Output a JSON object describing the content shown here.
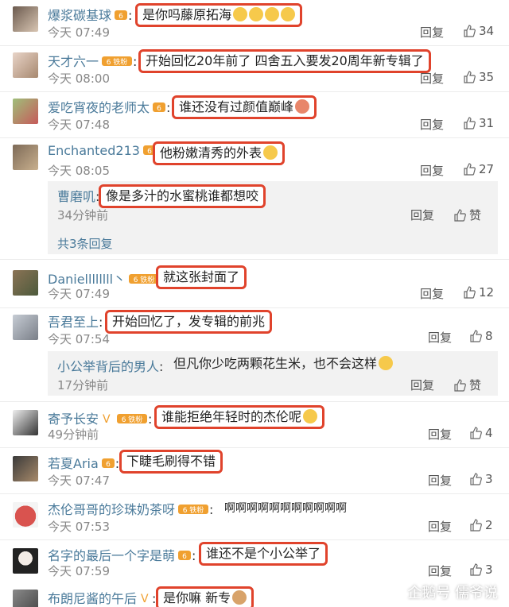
{
  "comments": [
    {
      "name": "爆浆碳基球",
      "content": "是你吗藤原拓海",
      "time": "今天 07:49",
      "reply": "回复",
      "likes": "34"
    },
    {
      "name": "天才六一",
      "content": "开始回忆20年前了 四舍五入要发20周年新专辑了",
      "time": "今天 08:00",
      "reply": "回复",
      "likes": "35"
    },
    {
      "name": "爱吃宵夜的老师太",
      "content": "谁还没有过颜值巅峰",
      "time": "今天 07:48",
      "reply": "回复",
      "likes": "31"
    },
    {
      "name": "Enchanted213",
      "content": "他粉嫩清秀的外表",
      "time": "今天 08:05",
      "reply": "回复",
      "likes": "27"
    },
    {
      "name": "Daniellllllll丶",
      "content": "就这张封面了",
      "time": "今天 07:49",
      "reply": "回复",
      "likes": "12"
    },
    {
      "name": "吾君至上",
      "content": "开始回忆了，发专辑的前兆",
      "time": "今天 07:54",
      "reply": "回复",
      "likes": "8"
    },
    {
      "name": "寄予长安",
      "content": "谁能拒绝年轻时的杰伦呢",
      "time": "49分钟前",
      "reply": "回复",
      "likes": "4"
    },
    {
      "name": "若夏Aria",
      "content": "下睫毛刷得不错",
      "time": "今天 07:47",
      "reply": "回复",
      "likes": "3"
    },
    {
      "name": "杰伦哥哥的珍珠奶茶呀",
      "content": "啊啊啊啊啊啊啊啊啊啊啊",
      "time": "今天 07:53",
      "reply": "回复",
      "likes": "2"
    },
    {
      "name": "名字的最后一个字是萌",
      "content": "谁还不是个小公举了",
      "time": "今天 07:59",
      "reply": "回复",
      "likes": "3"
    },
    {
      "name": "布朗尼酱的午后",
      "content": "是你嘛 新专"
    }
  ],
  "sub1": {
    "name": "曹磨叽",
    "content": "像是多汁的水蜜桃谁都想咬",
    "time": "34分钟前",
    "reply": "回复",
    "like": "赞",
    "more": "共3条回复"
  },
  "sub2": {
    "name": "小公举背后的男人",
    "content": "但凡你少吃两颗花生米，也不会这样",
    "time": "17分钟前",
    "reply": "回复",
    "like": "赞"
  },
  "badge_text": "铁粉",
  "watermark": "企鹅号 儒爷说"
}
